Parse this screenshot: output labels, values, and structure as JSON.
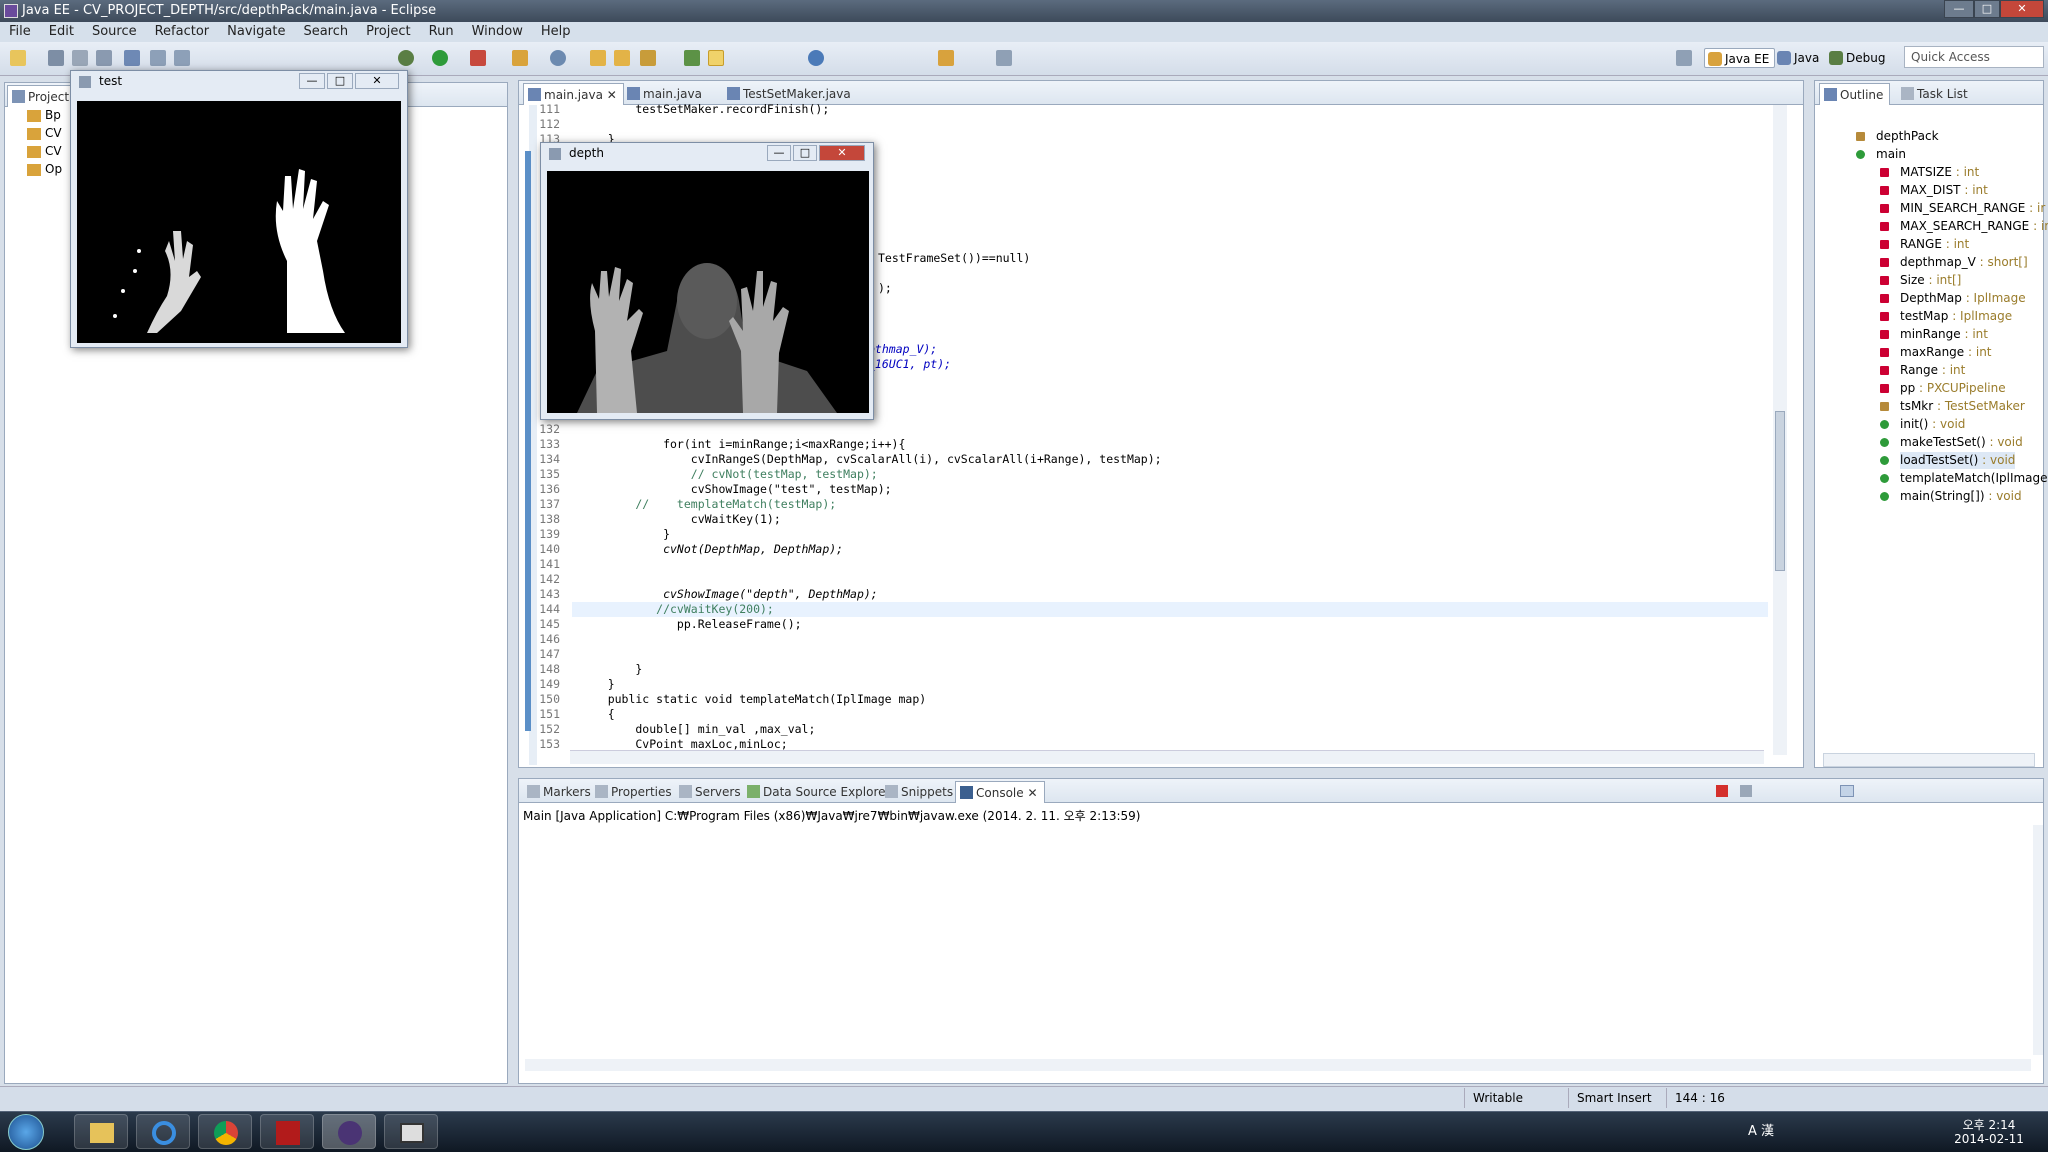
{
  "window": {
    "title": "Java EE - CV_PROJECT_DEPTH/src/depthPack/main.java - Eclipse",
    "min": "—",
    "max": "□",
    "close": "✕"
  },
  "menu": [
    "File",
    "Edit",
    "Source",
    "Refactor",
    "Navigate",
    "Search",
    "Project",
    "Run",
    "Window",
    "Help"
  ],
  "quick_access": "Quick Access",
  "perspectives": [
    "Java EE",
    "Java",
    "Debug"
  ],
  "project_panel": {
    "tab": "Project",
    "items": [
      "Bp",
      "CV",
      "CV",
      "Op"
    ]
  },
  "editor": {
    "tabs": [
      "main.java",
      "main.java",
      "TestSetMaker.java"
    ],
    "lines": [
      {
        "n": "111",
        "t": "        testSetMaker.recordFinish();"
      },
      {
        "n": "112",
        "t": ""
      },
      {
        "n": "113",
        "t": "    }"
      },
      {
        "n": "132",
        "t": ""
      },
      {
        "n": "133",
        "t": "            for(int i=minRange;i<maxRange;i++){"
      },
      {
        "n": "134",
        "t": "                cvInRangeS(DepthMap, cvScalarAll(i), cvScalarAll(i+Range), testMap);"
      },
      {
        "n": "135",
        "t": "                // cvNot(testMap, testMap);"
      },
      {
        "n": "136",
        "t": "                cvShowImage(\"test\", testMap);"
      },
      {
        "n": "137",
        "t": "        //    templateMatch(testMap);"
      },
      {
        "n": "138",
        "t": "                cvWaitKey(1);"
      },
      {
        "n": "139",
        "t": "            }"
      },
      {
        "n": "140",
        "t": "            cvNot(DepthMap, DepthMap);"
      },
      {
        "n": "141",
        "t": ""
      },
      {
        "n": "142",
        "t": ""
      },
      {
        "n": "143",
        "t": "            cvShowImage(\"depth\", DepthMap);"
      },
      {
        "n": "144",
        "t": "           //cvWaitKey(200);"
      },
      {
        "n": "145",
        "t": "              pp.ReleaseFrame();"
      },
      {
        "n": "146",
        "t": ""
      },
      {
        "n": "147",
        "t": ""
      },
      {
        "n": "148",
        "t": "        }"
      },
      {
        "n": "149",
        "t": "    }"
      },
      {
        "n": "150",
        "t": "    public static void templateMatch(IplImage map)"
      },
      {
        "n": "151",
        "t": "    {"
      },
      {
        "n": "152",
        "t": "        double[] min_val ,max_val;"
      },
      {
        "n": "153",
        "t": "        CvPoint maxLoc,minLoc;"
      }
    ],
    "fragments": [
      "TestFrameSet())==null)",
      ");",
      "pthmap_V);",
      "_16UC1, pt);"
    ]
  },
  "outline": {
    "tabs": [
      "Outline",
      "Task List"
    ],
    "package": "depthPack",
    "class": "main",
    "members": [
      {
        "name": "MATSIZE",
        "type": " : int"
      },
      {
        "name": "MAX_DIST",
        "type": " : int"
      },
      {
        "name": "MIN_SEARCH_RANGE",
        "type": " : ir"
      },
      {
        "name": "MAX_SEARCH_RANGE",
        "type": " : ir"
      },
      {
        "name": "RANGE",
        "type": " : int"
      },
      {
        "name": "depthmap_V",
        "type": " : short[]"
      },
      {
        "name": "Size",
        "type": " : int[]"
      },
      {
        "name": "DepthMap",
        "type": " : IplImage"
      },
      {
        "name": "testMap",
        "type": " : IplImage"
      },
      {
        "name": "minRange",
        "type": " : int"
      },
      {
        "name": "maxRange",
        "type": " : int"
      },
      {
        "name": "Range",
        "type": " : int"
      },
      {
        "name": "pp",
        "type": " : PXCUPipeline"
      },
      {
        "name": "tsMkr",
        "type": " : TestSetMaker"
      },
      {
        "name": "init()",
        "type": " : void"
      },
      {
        "name": "makeTestSet()",
        "type": " : void"
      },
      {
        "name": "loadTestSet()",
        "type": " : void"
      },
      {
        "name": "templateMatch(IplImage)",
        "type": ""
      },
      {
        "name": "main(String[])",
        "type": " : void"
      }
    ]
  },
  "bottom": {
    "tabs": [
      "Markers",
      "Properties",
      "Servers",
      "Data Source Explorer",
      "Snippets",
      "Console"
    ],
    "console_header": "Main [Java Application] C:₩Program Files (x86)₩Java₩jre7₩bin₩javaw.exe (2014. 2. 11. 오후 2:13:59)"
  },
  "status": {
    "mode": "Writable",
    "insert": "Smart Insert",
    "pos": "144 : 16"
  },
  "windows": {
    "test": "test",
    "depth": "depth"
  },
  "taskbar": {
    "time": "오후 2:14",
    "date": "2014-02-11",
    "tray": "A 漢"
  },
  "colors": {
    "keyword": "#7f0055",
    "field": "#0000c0",
    "string": "#2a00ff",
    "comment": "#3f7f5f"
  }
}
